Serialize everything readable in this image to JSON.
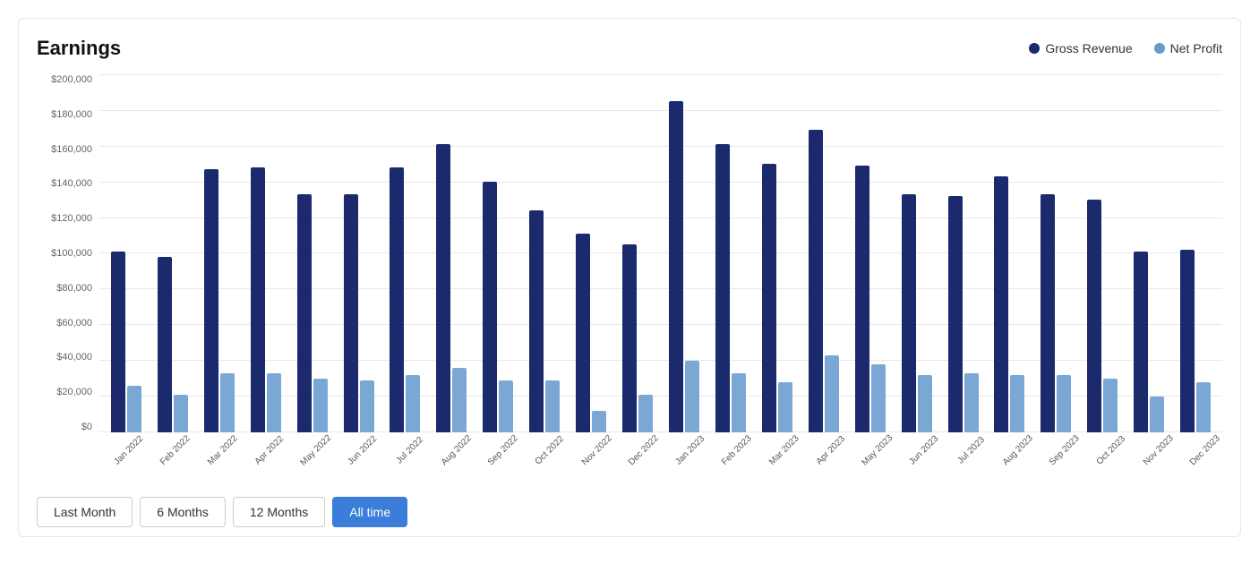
{
  "chart": {
    "title": "Earnings",
    "legend": {
      "gross_revenue_label": "Gross Revenue",
      "net_profit_label": "Net Profit"
    },
    "y_axis": {
      "labels": [
        "$0",
        "$20,000",
        "$40,000",
        "$60,000",
        "$80,000",
        "$100,000",
        "$120,000",
        "$140,000",
        "$160,000",
        "$180,000",
        "$200,000"
      ],
      "max": 200000
    },
    "months": [
      {
        "label": "Jan 2022",
        "gross": 101000,
        "net": 26000
      },
      {
        "label": "Feb 2022",
        "gross": 98000,
        "net": 21000
      },
      {
        "label": "Mar 2022",
        "gross": 147000,
        "net": 33000
      },
      {
        "label": "Apr 2022",
        "gross": 148000,
        "net": 33000
      },
      {
        "label": "May 2022",
        "gross": 133000,
        "net": 30000
      },
      {
        "label": "Jun 2022",
        "gross": 133000,
        "net": 29000
      },
      {
        "label": "Jul 2022",
        "gross": 148000,
        "net": 32000
      },
      {
        "label": "Aug 2022",
        "gross": 161000,
        "net": 36000
      },
      {
        "label": "Sep 2022",
        "gross": 140000,
        "net": 29000
      },
      {
        "label": "Oct 2022",
        "gross": 124000,
        "net": 29000
      },
      {
        "label": "Nov 2022",
        "gross": 111000,
        "net": 12000
      },
      {
        "label": "Dec 2022",
        "gross": 105000,
        "net": 21000
      },
      {
        "label": "Jan 2023",
        "gross": 185000,
        "net": 40000
      },
      {
        "label": "Feb 2023",
        "gross": 161000,
        "net": 33000
      },
      {
        "label": "Mar 2023",
        "gross": 150000,
        "net": 28000
      },
      {
        "label": "Apr 2023",
        "gross": 169000,
        "net": 43000
      },
      {
        "label": "May 2023",
        "gross": 149000,
        "net": 38000
      },
      {
        "label": "Jun 2023",
        "gross": 133000,
        "net": 32000
      },
      {
        "label": "Jul 2023",
        "gross": 132000,
        "net": 33000
      },
      {
        "label": "Aug 2023",
        "gross": 143000,
        "net": 32000
      },
      {
        "label": "Sep 2023",
        "gross": 133000,
        "net": 32000
      },
      {
        "label": "Oct 2023",
        "gross": 130000,
        "net": 30000
      },
      {
        "label": "Nov 2023",
        "gross": 101000,
        "net": 20000
      },
      {
        "label": "Dec 2023",
        "gross": 102000,
        "net": 28000
      }
    ]
  },
  "filters": {
    "buttons": [
      {
        "label": "Last Month",
        "id": "last-month",
        "active": false
      },
      {
        "label": "6 Months",
        "id": "6-months",
        "active": false
      },
      {
        "label": "12 Months",
        "id": "12-months",
        "active": false
      },
      {
        "label": "All time",
        "id": "all-time",
        "active": true
      }
    ]
  }
}
